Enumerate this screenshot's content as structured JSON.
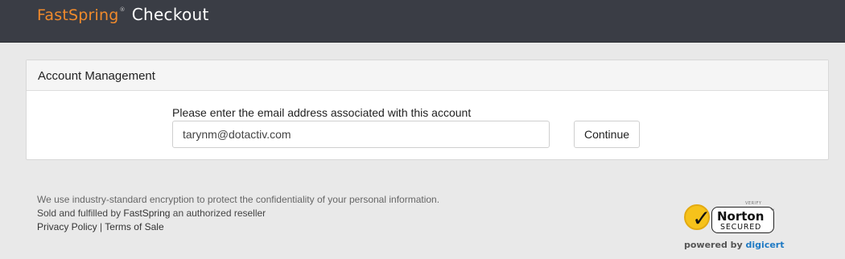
{
  "header": {
    "logo_fast": "Fast",
    "logo_spring": "Spring",
    "logo_reg": "®",
    "title": "Checkout"
  },
  "panel": {
    "title": "Account Management",
    "prompt": "Please enter the email address associated with this account",
    "email_value": "tarynm@dotactiv.com",
    "continue_label": "Continue"
  },
  "footer": {
    "line1": "We use industry-standard encryption to protect the confidentiality of your personal information.",
    "line2_prefix": "Sold and fulfilled by ",
    "line2_brand": "FastSpring",
    "line2_suffix": " an authorized reseller",
    "privacy_link": "Privacy Policy",
    "separator": " | ",
    "terms_link": "Terms of Sale"
  },
  "norton_badge": {
    "verify": "VERIFY",
    "name": "Norton",
    "tm": "™",
    "secured": "SECURED",
    "powered_by": "powered by ",
    "digicert": "digicert"
  },
  "colors": {
    "topbar": "#3a3d45",
    "brand_orange": "#f08a2c",
    "page_bg": "#e9e9e9",
    "digicert_blue": "#1f7ac4"
  }
}
